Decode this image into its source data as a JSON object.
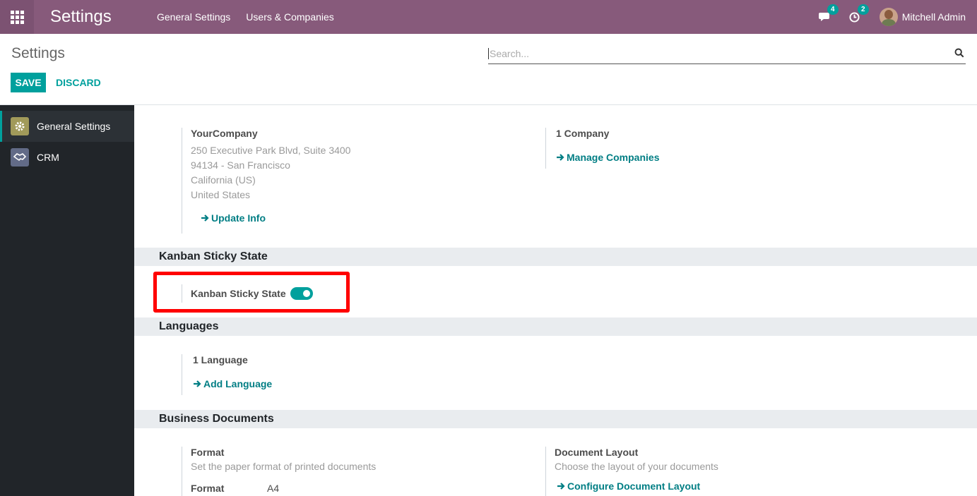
{
  "navbar": {
    "app_title": "Settings",
    "menu": [
      "General Settings",
      "Users & Companies"
    ],
    "messages_count": "4",
    "activities_count": "2",
    "user_name": "Mitchell Admin"
  },
  "control_panel": {
    "breadcrumb": "Settings",
    "search_placeholder": "Search...",
    "save_label": "SAVE",
    "discard_label": "DISCARD"
  },
  "sidebar": {
    "items": [
      {
        "label": "General Settings",
        "icon": "gear-icon",
        "active": true
      },
      {
        "label": "CRM",
        "icon": "handshake-icon",
        "active": false
      }
    ]
  },
  "companies": {
    "company_name": "YourCompany",
    "address": [
      "250 Executive Park Blvd, Suite 3400",
      "94134 - San Francisco",
      "California (US)",
      "United States"
    ],
    "update_info": "Update Info",
    "count": "1 Company",
    "manage": "Manage Companies"
  },
  "kanban": {
    "section_title": "Kanban Sticky State",
    "setting_label": "Kanban Sticky State",
    "enabled": true
  },
  "languages": {
    "section_title": "Languages",
    "count": "1 Language",
    "add": "Add Language"
  },
  "business_documents": {
    "section_title": "Business Documents",
    "format_title": "Format",
    "format_desc": "Set the paper format of printed documents",
    "format_field_label": "Format",
    "format_value": "A4",
    "layout_title": "Document Layout",
    "layout_desc": "Choose the layout of your documents",
    "configure": "Configure Document Layout"
  },
  "colors": {
    "navbar": "#875a7b",
    "primary": "#00a09d",
    "sidebar": "#212529",
    "highlight": "#ff0000"
  }
}
